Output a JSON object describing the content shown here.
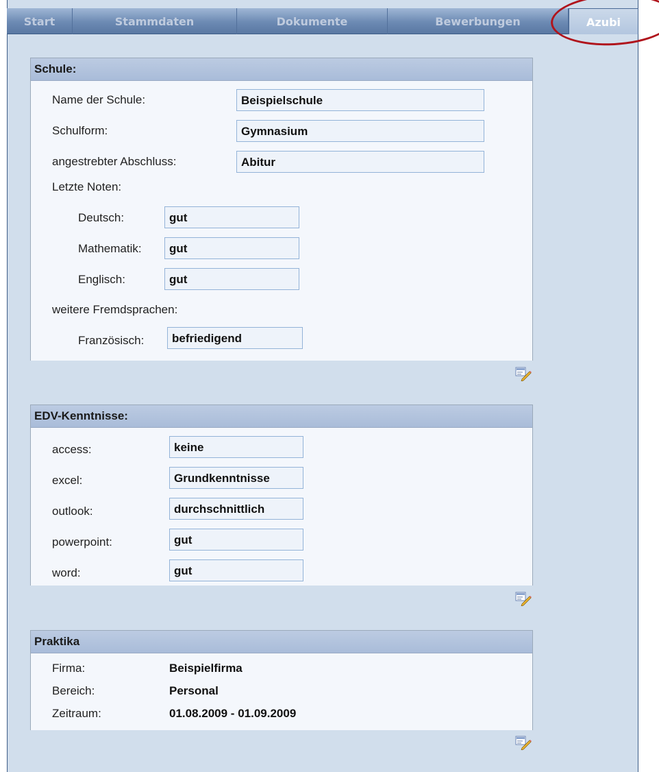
{
  "tabs": [
    {
      "label": "Start"
    },
    {
      "label": "Stammdaten"
    },
    {
      "label": "Dokumente"
    },
    {
      "label": "Bewerbungen"
    },
    {
      "label": "Azubi"
    }
  ],
  "active_tab": "Azubi",
  "schule": {
    "title": "Schule:",
    "name_label": "Name der Schule:",
    "name_value": "Beispielschule",
    "schulform_label": "Schulform:",
    "schulform_value": "Gymnasium",
    "abschluss_label": "angestrebter Abschluss:",
    "abschluss_value": "Abitur",
    "noten_label": "Letzte Noten:",
    "noten": [
      {
        "label": "Deutsch:",
        "value": "gut"
      },
      {
        "label": "Mathematik:",
        "value": "gut"
      },
      {
        "label": "Englisch:",
        "value": "gut"
      }
    ],
    "fremdsprachen_label": "weitere Fremdsprachen:",
    "fremdsprachen": [
      {
        "label": "Französisch:",
        "value": "befriedigend"
      }
    ]
  },
  "edv": {
    "title": "EDV-Kenntnisse:",
    "items": [
      {
        "label": "access:",
        "value": "keine"
      },
      {
        "label": "excel:",
        "value": "Grundkenntnisse"
      },
      {
        "label": "outlook:",
        "value": "durchschnittlich"
      },
      {
        "label": "powerpoint:",
        "value": "gut"
      },
      {
        "label": "word:",
        "value": "gut"
      }
    ]
  },
  "praktika": {
    "title": "Praktika",
    "firma_label": "Firma:",
    "firma_value": "Beispielfirma",
    "bereich_label": "Bereich:",
    "bereich_value": "Personal",
    "zeitraum_label": "Zeitraum:",
    "zeitraum_value": "01.08.2009 - 01.09.2009"
  },
  "colors": {
    "highlight": "#b0141c",
    "tabbar": "#6c8ab3",
    "panel_header": "#b3c4de"
  }
}
